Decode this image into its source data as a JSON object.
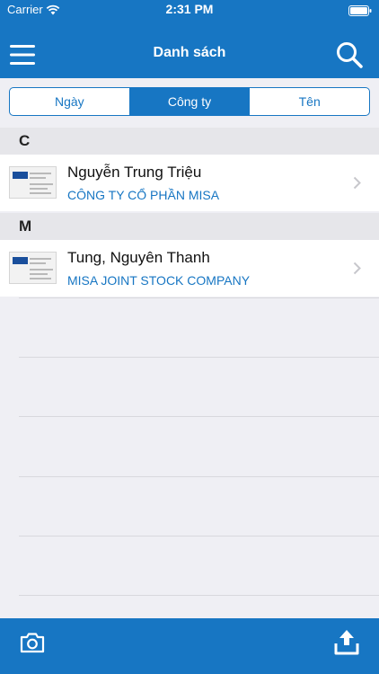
{
  "status_bar": {
    "carrier": "Carrier",
    "time": "2:31 PM",
    "icons": [
      "wifi-icon",
      "battery-icon"
    ]
  },
  "nav": {
    "title": "Danh sách",
    "left_icon": "menu-icon",
    "right_icon": "search-icon"
  },
  "segments": {
    "items": [
      "Ngày",
      "Công ty",
      "Tên"
    ],
    "selected": "Công ty"
  },
  "sections": [
    {
      "header": "C",
      "rows": [
        {
          "name": "Nguyễn Trung Triệu",
          "company": "CÔNG TY CỔ PHẦN MISA"
        }
      ]
    },
    {
      "header": "M",
      "rows": [
        {
          "name": "Tung, Nguyên Thanh",
          "company": "MISA JOINT STOCK COMPANY"
        }
      ]
    }
  ],
  "toolbar": {
    "left_icon": "camera-icon",
    "right_icon": "upload-icon"
  },
  "colors": {
    "primary": "#1776c3",
    "background": "#efeff4",
    "section_header": "#e6e6ea",
    "row": "#ffffff"
  }
}
